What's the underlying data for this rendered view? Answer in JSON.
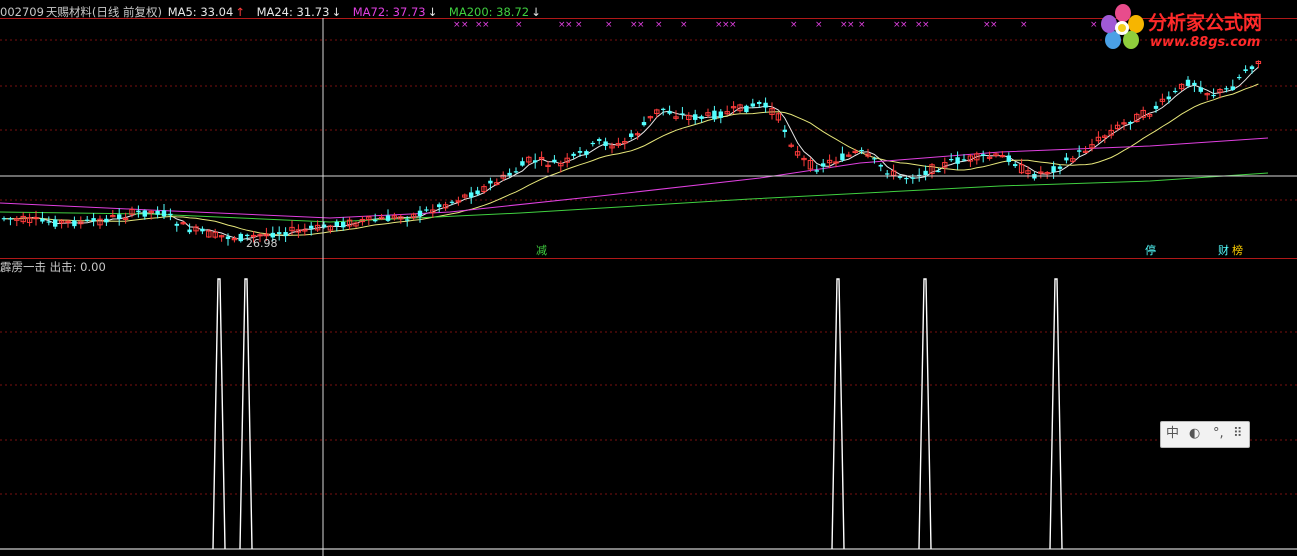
{
  "header": {
    "code": "002709",
    "name": "天赐材料(日线 前复权)",
    "ma5": "MA5: 33.04",
    "ma24": "MA24: 31.73",
    "ma72": "MA72: 37.73",
    "ma200": "MA200: 38.72",
    "arrow_up": "↑",
    "arrow_down": "↓"
  },
  "colors": {
    "up": "#ff3c3c",
    "down": "#54ffff",
    "ma5": "#e8e8e8",
    "ma24": "#e6e67a",
    "ma72": "#e040e0",
    "ma200": "#40d040",
    "ma5_label": "#e8e8e8",
    "ma72_label": "#e040e0",
    "ma200_label": "#40d040",
    "signal": "#ffffff",
    "grid": "#7a1010",
    "border": "#b01818"
  },
  "price_chart": {
    "low_label": "26.98",
    "markers": [
      "减",
      "停",
      "财",
      "榜"
    ]
  },
  "indicator": {
    "title": "霹雳一击 出击: 0.00"
  },
  "logo": {
    "text": "分析家公式网",
    "url": "www.88gs.com"
  },
  "ime_toolbar": {
    "items": [
      "中",
      "◐",
      "°,",
      "⠿"
    ]
  }
}
